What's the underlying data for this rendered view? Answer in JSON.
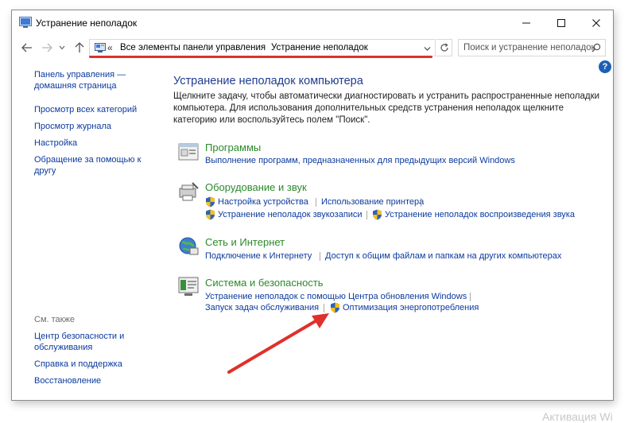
{
  "window": {
    "title": "Устранение неполадок"
  },
  "address": {
    "prefix": "«",
    "crumbs": [
      "Все элементы панели управления",
      "Устранение неполадок"
    ],
    "separator": "›"
  },
  "search": {
    "placeholder": "Поиск и устранение неполадок"
  },
  "sidebar": {
    "items": [
      "Панель управления —",
      "домашняя страница",
      "Просмотр всех категорий",
      "Просмотр журнала",
      "Настройка",
      "Обращение за помощью к",
      "другу"
    ],
    "see_also_heading": "См. также",
    "see_also": [
      "Центр безопасности и",
      "обслуживания",
      "Справка и поддержка",
      "Восстановление"
    ]
  },
  "main": {
    "title": "Устранение неполадок компьютера",
    "description": "Щелкните задачу, чтобы автоматически диагностировать и устранить распространенные неполадки компьютера. Для использования дополнительных средств устранения неполадок щелкните категорию или воспользуйтесь полем \"Поиск\"."
  },
  "categories": [
    {
      "title": "Программы",
      "links": [
        "Выполнение программ, предназначенных для предыдущих версий Windows"
      ]
    },
    {
      "title": "Оборудование и звук",
      "links": [
        "Настройка устройства",
        "Использование принтера",
        "Устранение неполадок звукозаписи",
        "Устранение неполадок воспроизведения звука"
      ]
    },
    {
      "title": "Сеть и Интернет",
      "links": [
        "Подключение к Интернету",
        "Доступ к общим файлам и папкам на других компьютерах"
      ]
    },
    {
      "title": "Система и безопасность",
      "links": [
        "Устранение неполадок с помощью Центра обновления Windows",
        "Запуск задач обслуживания",
        "Оптимизация энергопотребления"
      ]
    }
  ],
  "watermark": "Активация Wi",
  "colors": {
    "link": "#0b3a9e",
    "category": "#2b8a2b",
    "title": "#1e3b8f",
    "annotation": "#e0302a",
    "shield_blue": "#2f63b8",
    "shield_yellow": "#f2c21b"
  }
}
